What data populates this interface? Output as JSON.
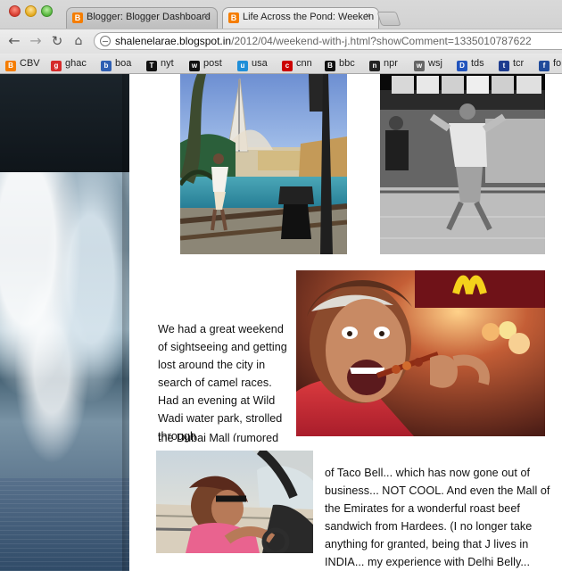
{
  "browser": {
    "tabs": [
      {
        "label": "Blogger: Blogger Dashboard",
        "favicon": "B",
        "active": false
      },
      {
        "label": "Life Across the Pond: Weeken",
        "favicon": "B",
        "active": true
      }
    ],
    "address": {
      "host": "shalenelarae.blogspot.in",
      "path": "/2012/04/weekend-with-j.html?showComment=1335010787622"
    },
    "bookmarks": [
      {
        "label": "CBV",
        "icon": "blogger-icon",
        "color": "#f57d00"
      },
      {
        "label": "ghac",
        "icon": "ghac-icon",
        "color": "#d52a2a"
      },
      {
        "label": "boa",
        "icon": "boa-icon",
        "color": "#2f5fb3"
      },
      {
        "label": "nyt",
        "icon": "nyt-icon",
        "color": "#111111"
      },
      {
        "label": "post",
        "icon": "washington-post-icon",
        "color": "#111111"
      },
      {
        "label": "usa",
        "icon": "usa-icon",
        "color": "#1f8ed8"
      },
      {
        "label": "cnn",
        "icon": "cnn-icon",
        "color": "#cc0000"
      },
      {
        "label": "bbc",
        "icon": "bbc-icon",
        "color": "#111111"
      },
      {
        "label": "npr",
        "icon": "npr-icon",
        "color": "#222222"
      },
      {
        "label": "wsj",
        "icon": "wsj-icon",
        "color": "#666666"
      },
      {
        "label": "tds",
        "icon": "tds-icon",
        "color": "#2254bd"
      },
      {
        "label": "tcr",
        "icon": "tcr-icon",
        "color": "#1e3c8f"
      },
      {
        "label": "fo",
        "icon": "fo-icon",
        "color": "#204b9b"
      }
    ]
  },
  "post": {
    "paragraph_left": "We had a great weekend of sightseeing and getting lost around the city in search of camel races.  Had an evening at Wild Wadi water park, strolled through",
    "paragraph_fade": "the Dubai Mall (rumored",
    "paragraph_right": "of Taco Bell... which has now gone out of business... NOT COOL.  And even the Mall of the Emirates for a wonderful roast beef sandwich from Hardees. (I no longer take anything for granted, being that J lives in INDIA... my experience with Delhi Belly..."
  },
  "colors": {
    "blogger_orange": "#f57d00",
    "page_text": "#111111",
    "chrome_gray": "#d9d9d9"
  }
}
